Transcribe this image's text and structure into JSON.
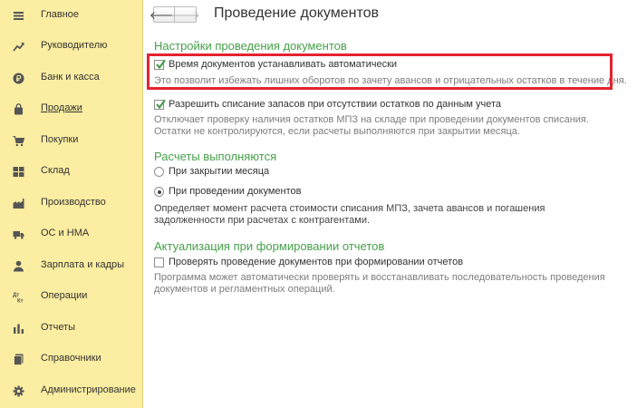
{
  "sidebar": {
    "items": [
      {
        "label": "Главное",
        "icon": "hamburger-menu-icon",
        "active": false
      },
      {
        "label": "Руководителю",
        "icon": "trend-chart-icon",
        "active": false
      },
      {
        "label": "Банк и касса",
        "icon": "ruble-coin-icon",
        "active": false
      },
      {
        "label": "Продажи",
        "icon": "shopping-bag-icon",
        "active": true
      },
      {
        "label": "Покупки",
        "icon": "shopping-cart-icon",
        "active": false
      },
      {
        "label": "Склад",
        "icon": "warehouse-grid-icon",
        "active": false
      },
      {
        "label": "Производство",
        "icon": "factory-icon",
        "active": false
      },
      {
        "label": "ОС и НМА",
        "icon": "truck-icon",
        "active": false
      },
      {
        "label": "Зарплата и кадры",
        "icon": "person-icon",
        "active": false
      },
      {
        "label": "Операции",
        "icon": "debit-credit-icon",
        "active": false
      },
      {
        "label": "Отчеты",
        "icon": "bar-chart-icon",
        "active": false
      },
      {
        "label": "Справочники",
        "icon": "book-icon",
        "active": false
      },
      {
        "label": "Администрирование",
        "icon": "gear-icon",
        "active": false
      }
    ]
  },
  "header": {
    "back_glyph": "🡐",
    "forward_glyph": "🡒",
    "title": "Проведение документов"
  },
  "sections": {
    "settings": {
      "title": "Настройки проведения документов",
      "auto_time": {
        "label": "Время документов устанавливать автоматически",
        "checked": true,
        "hint": "Это позволит избежать лишних оборотов по зачету авансов и отрицательных остатков в течение дня."
      },
      "allow_writeoff": {
        "label": "Разрешить списание запасов при отсутствии остатков по данным учета",
        "checked": true,
        "hint_line1": "Отключает проверку наличия остатков МПЗ на складе при проведении документов списания.",
        "hint_line2": "Остатки не контролируются, если расчеты выполняются при закрытии месяца."
      }
    },
    "calculations": {
      "title": "Расчеты выполняются",
      "options": [
        {
          "label": "При закрытии месяца",
          "selected": false
        },
        {
          "label": "При проведении документов",
          "selected": true
        }
      ],
      "hint_line1": "Определяет момент расчета стоимости списания МПЗ, зачета авансов и погашения",
      "hint_line2": "задолженности при расчетах с контрагентами."
    },
    "reports": {
      "title": "Актуализация при формировании отчетов",
      "check_docs": {
        "label": "Проверять проведение документов при формировании отчетов",
        "checked": false
      },
      "hint_line1": "Программа может автоматически проверять и восстанавливать последовательность проведения",
      "hint_line2": "документов и регламентных операций."
    }
  },
  "colors": {
    "sidebar_bg": "#fbeda1",
    "section_title": "#47a04a",
    "checkmark": "#3c9a3f",
    "highlight_frame": "#e52330"
  }
}
